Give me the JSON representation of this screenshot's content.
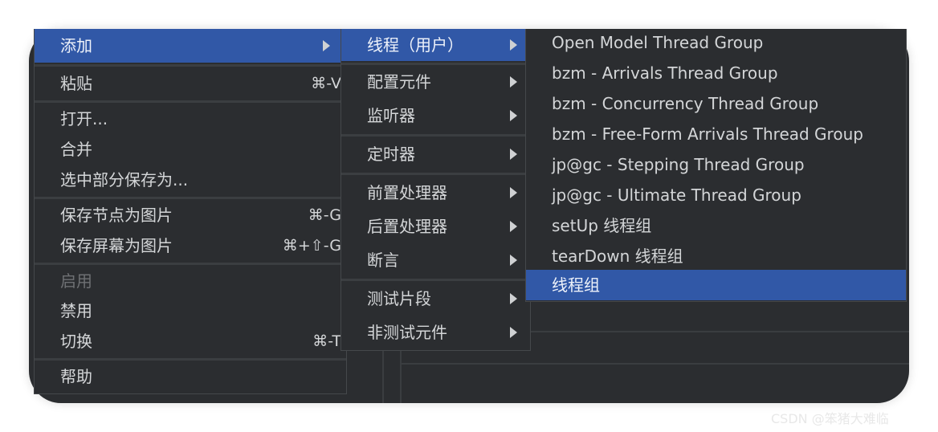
{
  "context_menu": {
    "items": [
      {
        "label": "添加",
        "shortcut": "",
        "submenu": true,
        "highlighted": true
      },
      {
        "label": "粘贴",
        "shortcut": "⌘-V"
      },
      {
        "label": "打开...",
        "shortcut": ""
      },
      {
        "label": "合并",
        "shortcut": ""
      },
      {
        "label": "选中部分保存为...",
        "shortcut": ""
      },
      {
        "label": "保存节点为图片",
        "shortcut": "⌘-G"
      },
      {
        "label": "保存屏幕为图片",
        "shortcut": "⌘+⇧-G"
      },
      {
        "label": "启用",
        "shortcut": "",
        "disabled": true
      },
      {
        "label": "禁用",
        "shortcut": ""
      },
      {
        "label": "切换",
        "shortcut": "⌘-T"
      },
      {
        "label": "帮助",
        "shortcut": ""
      }
    ]
  },
  "add_submenu": {
    "items": [
      {
        "label": "线程（用户）",
        "highlighted": true
      },
      {
        "label": "配置元件"
      },
      {
        "label": "监听器"
      },
      {
        "label": "定时器"
      },
      {
        "label": "前置处理器"
      },
      {
        "label": "后置处理器"
      },
      {
        "label": "断言"
      },
      {
        "label": "测试片段"
      },
      {
        "label": "非测试元件"
      }
    ]
  },
  "threads_submenu": {
    "items": [
      {
        "label": "Open Model Thread Group"
      },
      {
        "label": "bzm - Arrivals Thread Group"
      },
      {
        "label": "bzm - Concurrency Thread Group"
      },
      {
        "label": "bzm - Free-Form Arrivals Thread Group"
      },
      {
        "label": "jp@gc - Stepping Thread Group"
      },
      {
        "label": "jp@gc - Ultimate Thread Group"
      },
      {
        "label": "setUp 线程组"
      },
      {
        "label": "tearDown 线程组"
      },
      {
        "label": "线程组",
        "highlighted": true
      }
    ]
  },
  "watermark": "CSDN @笨猪大难临",
  "colors": {
    "highlight": "#3158a7",
    "menu_bg": "#2b2d30"
  }
}
